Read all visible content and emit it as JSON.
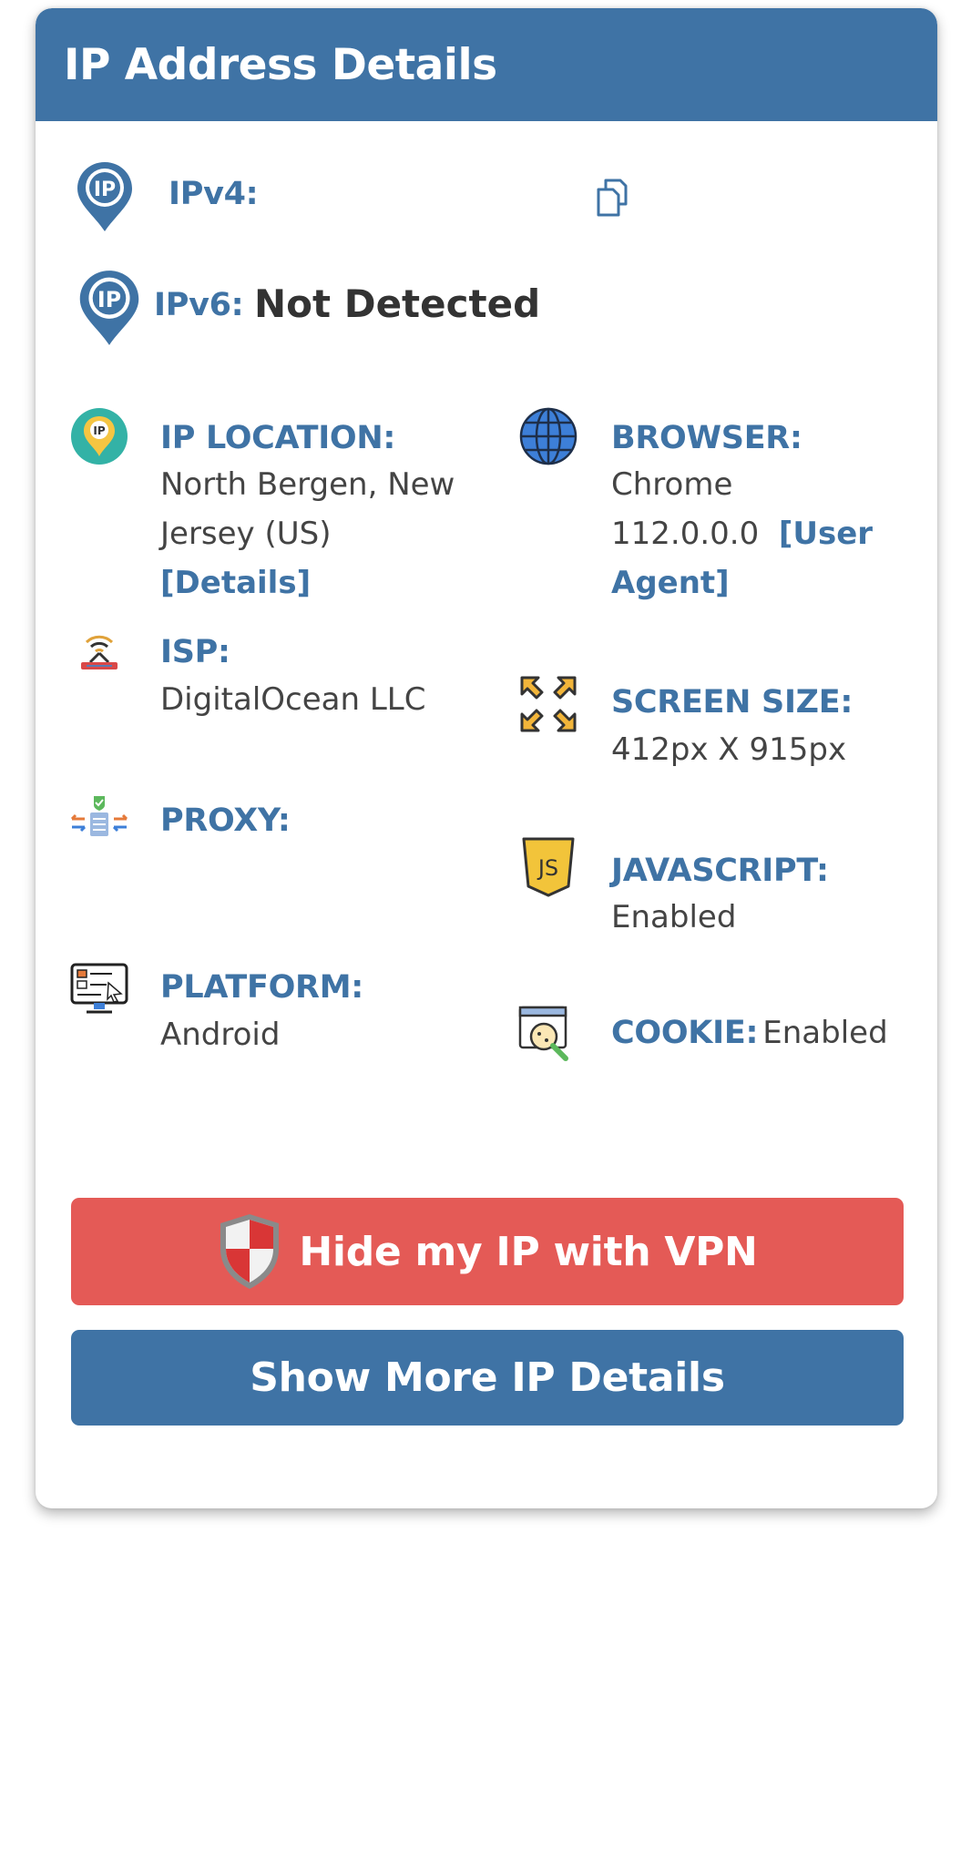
{
  "header": {
    "title": "IP Address Details"
  },
  "ipv4": {
    "label": "IPv4:",
    "value": ""
  },
  "ipv6": {
    "label": "IPv6:",
    "value": "Not Detected"
  },
  "location": {
    "label": "IP LOCATION:",
    "value": "North Bergen, New Jersey (US)",
    "link": "[Details]"
  },
  "browser": {
    "label": "BROWSER:",
    "value": "Chrome 112.0.0.0",
    "link": "[User Agent]"
  },
  "isp": {
    "label": "ISP:",
    "value": "DigitalOcean LLC"
  },
  "screen": {
    "label": "SCREEN SIZE:",
    "value": "412px X 915px"
  },
  "proxy": {
    "label": "PROXY:",
    "value": ""
  },
  "javascript": {
    "label": "JAVASCRIPT:",
    "value": "Enabled"
  },
  "platform": {
    "label": "PLATFORM:",
    "value": "Android"
  },
  "cookie": {
    "label": "COOKIE:",
    "value": "Enabled"
  },
  "buttons": {
    "vpn": "Hide my IP with VPN",
    "more": "Show More IP Details"
  },
  "icons": [
    "ip-pin-icon",
    "copy-icon",
    "ip-location-icon",
    "globe-icon",
    "router-icon",
    "expand-icon",
    "proxy-icon",
    "javascript-icon",
    "monitor-icon",
    "cookie-search-icon",
    "shield-icon"
  ],
  "colors": {
    "primary": "#3f73a5",
    "danger": "#e45a56",
    "text": "#444444"
  }
}
